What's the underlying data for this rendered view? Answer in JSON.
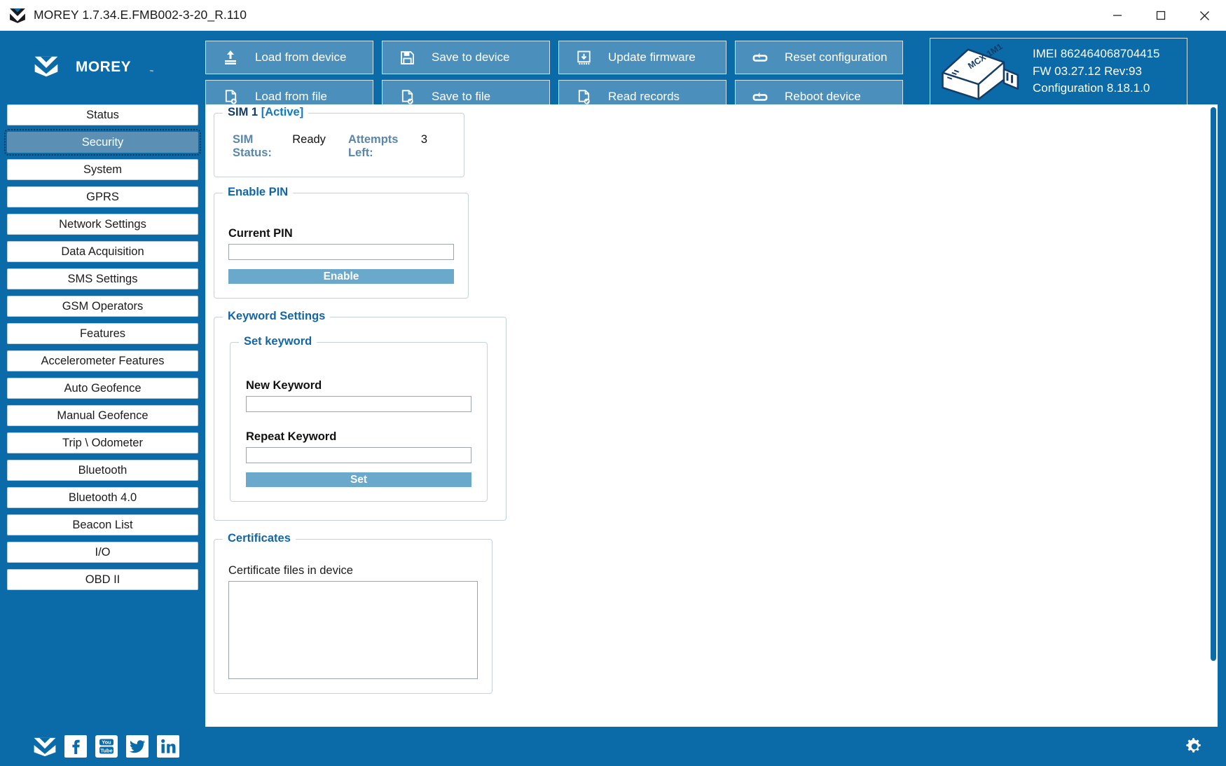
{
  "window": {
    "title": "MOREY 1.7.34.E.FMB002-3-20_R.110",
    "app_icon": "morey-chevron-icon",
    "minimize": "minimize-icon",
    "maximize": "maximize-icon",
    "close": "close-icon"
  },
  "brand": {
    "name": "MOREY",
    "trademark": "TM"
  },
  "toolbar": {
    "buttons": [
      {
        "label": "Load from device",
        "icon": "upload-to-device-icon"
      },
      {
        "label": "Save to device",
        "icon": "floppy-disk-icon"
      },
      {
        "label": "Update firmware",
        "icon": "firmware-download-icon"
      },
      {
        "label": "Reset configuration",
        "icon": "reset-loop-icon"
      },
      {
        "label": "Load from file",
        "icon": "file-load-icon"
      },
      {
        "label": "Save to file",
        "icon": "file-save-icon"
      },
      {
        "label": "Read records",
        "icon": "file-records-icon"
      },
      {
        "label": "Reboot device",
        "icon": "reboot-loop-icon"
      }
    ]
  },
  "device": {
    "image_label": "MCX-1M1",
    "imei_label": "IMEI",
    "imei_value": "862464068704415",
    "fw_label": "FW",
    "fw_value": "03.27.12 Rev:93",
    "config_label": "Configuration",
    "config_value": "8.18.1.0"
  },
  "sidebar": {
    "items": [
      {
        "label": "Status",
        "active": false
      },
      {
        "label": "Security",
        "active": true
      },
      {
        "label": "System",
        "active": false
      },
      {
        "label": "GPRS",
        "active": false
      },
      {
        "label": "Network Settings",
        "active": false
      },
      {
        "label": "Data Acquisition",
        "active": false
      },
      {
        "label": "SMS Settings",
        "active": false
      },
      {
        "label": "GSM Operators",
        "active": false
      },
      {
        "label": "Features",
        "active": false
      },
      {
        "label": "Accelerometer Features",
        "active": false
      },
      {
        "label": "Auto Geofence",
        "active": false
      },
      {
        "label": "Manual Geofence",
        "active": false
      },
      {
        "label": "Trip \\ Odometer",
        "active": false
      },
      {
        "label": "Bluetooth",
        "active": false
      },
      {
        "label": "Bluetooth 4.0",
        "active": false
      },
      {
        "label": "Beacon List",
        "active": false
      },
      {
        "label": "I/O",
        "active": false
      },
      {
        "label": "OBD II",
        "active": false
      }
    ]
  },
  "main": {
    "sim": {
      "group_title_main": "SIM 1",
      "group_title_state": "[Active]",
      "status_label": "SIM Status:",
      "status_value": "Ready",
      "attempts_label": "Attempts Left:",
      "attempts_value": "3"
    },
    "enable_pin": {
      "group_title": "Enable PIN",
      "current_pin_label": "Current PIN",
      "current_pin_value": "",
      "current_pin_placeholder": "",
      "enable_button": "Enable"
    },
    "keyword_settings": {
      "group_title": "Keyword Settings",
      "set_keyword": {
        "group_title": "Set keyword",
        "new_keyword_label": "New Keyword",
        "new_keyword_value": "",
        "repeat_keyword_label": "Repeat Keyword",
        "repeat_keyword_value": "",
        "set_button": "Set"
      }
    },
    "certificates": {
      "group_title": "Certificates",
      "files_label": "Certificate files in device",
      "files": []
    }
  },
  "footer": {
    "social": [
      {
        "name": "morey-chevron-icon"
      },
      {
        "name": "facebook-icon"
      },
      {
        "name": "youtube-icon"
      },
      {
        "name": "twitter-icon"
      },
      {
        "name": "linkedin-icon"
      }
    ],
    "settings_icon": "gear-icon"
  },
  "colors": {
    "brand_blue": "#0a6ba8",
    "button_blue": "#4b90bd",
    "action_blue": "#6aa8cc",
    "group_title_blue": "#1266a8",
    "active_nav": "#5b8fb4"
  }
}
